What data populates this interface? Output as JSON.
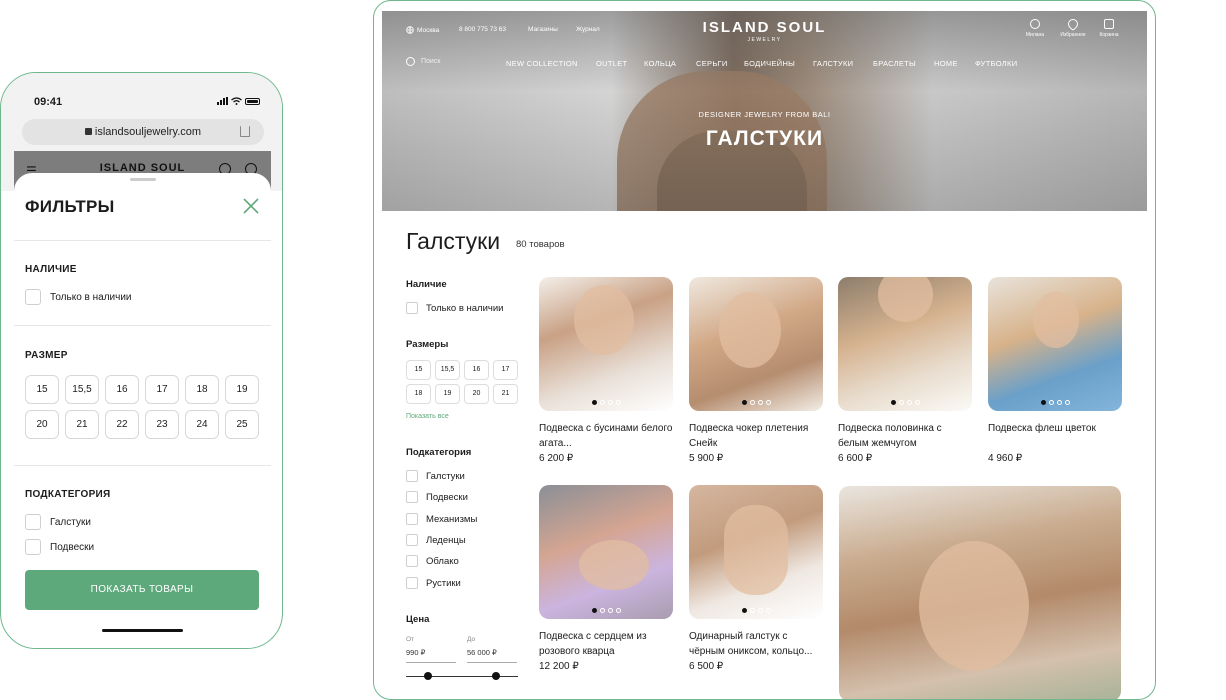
{
  "mobile": {
    "time": "09:41",
    "url": "islandsouljewelry.com",
    "site_logo": "ISLAND SOUL",
    "menu_icon": "☰",
    "filters_title": "ФИЛЬТРЫ",
    "availability": {
      "title": "НАЛИЧИЕ",
      "option": "Только в наличии"
    },
    "sizes": {
      "title": "РАЗМЕР",
      "values": [
        "15",
        "15,5",
        "16",
        "17",
        "18",
        "19",
        "20",
        "21",
        "22",
        "23",
        "24",
        "25"
      ]
    },
    "subcategory": {
      "title": "ПОДКАТЕГОРИЯ",
      "options": [
        "Галстуки",
        "Подвески"
      ]
    },
    "show_button": "ПОКАЗАТЬ ТОВАРЫ"
  },
  "desktop": {
    "header": {
      "city": "Москва",
      "phone": "8 800 775 73 63",
      "stores": "Магазины",
      "journal": "Журнал",
      "logo": "ISLAND SOUL",
      "logo_sub": "JEWELRY",
      "user": "Милана",
      "favorites": "Избранное",
      "cart": "Корзина",
      "search": "Поиск",
      "nav": [
        "NEW COLLECTION",
        "OUTLET",
        "КОЛЬЦА",
        "СЕРЬГИ",
        "БОДИЧЕЙНЫ",
        "ГАЛСТУКИ",
        "БРАСЛЕТЫ",
        "HOME",
        "ФУТБОЛКИ"
      ]
    },
    "hero": {
      "subtitle": "DESIGNER JEWELRY FROM BALI",
      "title": "ГАЛСТУКИ"
    },
    "page_title": "Галстуки",
    "product_count": "80 товаров",
    "filters": {
      "availability": {
        "title": "Наличие",
        "option": "Только в наличии"
      },
      "sizes": {
        "title": "Размеры",
        "values": [
          "15",
          "15,5",
          "16",
          "17",
          "18",
          "19",
          "20",
          "21"
        ],
        "show_all": "Показать все"
      },
      "subcategory": {
        "title": "Подкатегория",
        "options": [
          "Галстуки",
          "Подвески",
          "Механизмы",
          "Леденцы",
          "Облако",
          "Рустики"
        ]
      },
      "price": {
        "title": "Цена",
        "from_label": "От",
        "from_value": "990 ₽",
        "to_label": "До",
        "to_value": "56 000 ₽"
      }
    },
    "products": [
      {
        "name": "Подвеска с бусинами белого агата...",
        "price": "6 200 ₽"
      },
      {
        "name": "Подвеска чокер плетения Снейк",
        "price": "5 900 ₽"
      },
      {
        "name": "Подвеска половинка с белым жемчугом",
        "price": "6 600 ₽"
      },
      {
        "name": "Подвеска флеш цветок",
        "price": "4 960 ₽"
      },
      {
        "name": "Подвеска с сердцем из розового кварца",
        "price": "12 200 ₽"
      },
      {
        "name": "Одинарный галстук с чёрным ониксом, кольцо...",
        "price": "6 500 ₽"
      }
    ]
  }
}
